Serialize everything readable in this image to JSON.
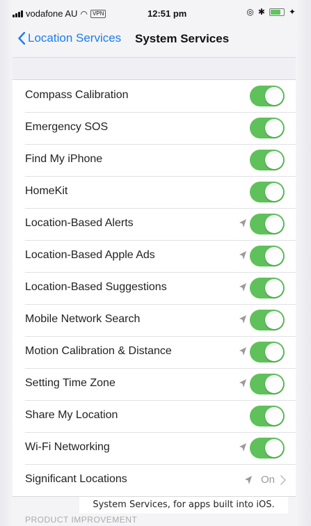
{
  "status_bar": {
    "carrier": "vodafone AU",
    "vpn": "VPN",
    "time": "12:51 pm"
  },
  "nav": {
    "back_label": "Location Services",
    "title": "System Services"
  },
  "colors": {
    "accent": "#1a7cf0",
    "toggle_on": "#5ec15a"
  },
  "items": [
    {
      "label": "Compass Calibration",
      "enabled": true
    },
    {
      "label": "Emergency SOS",
      "enabled": true
    },
    {
      "label": "Find My iPhone",
      "enabled": true
    },
    {
      "label": "HomeKit",
      "enabled": true
    },
    {
      "label": "Location-Based Alerts",
      "enabled": true,
      "location_arrow": true
    },
    {
      "label": "Location-Based Apple Ads",
      "enabled": true,
      "location_arrow": true
    },
    {
      "label": "Location-Based Suggestions",
      "enabled": true,
      "location_arrow": true
    },
    {
      "label": "Mobile Network Search",
      "enabled": true,
      "location_arrow": true
    },
    {
      "label": "Motion Calibration & Distance",
      "enabled": true,
      "location_arrow": true
    },
    {
      "label": "Setting Time Zone",
      "enabled": true,
      "location_arrow": true
    },
    {
      "label": "Share My Location",
      "enabled": true
    },
    {
      "label": "Wi-Fi Networking",
      "enabled": true,
      "location_arrow": true
    }
  ],
  "significant_locations": {
    "label": "Significant Locations",
    "value": "On"
  },
  "caption": "System Services, for apps built into iOS.",
  "section_footer": "PRODUCT IMPROVEMENT"
}
